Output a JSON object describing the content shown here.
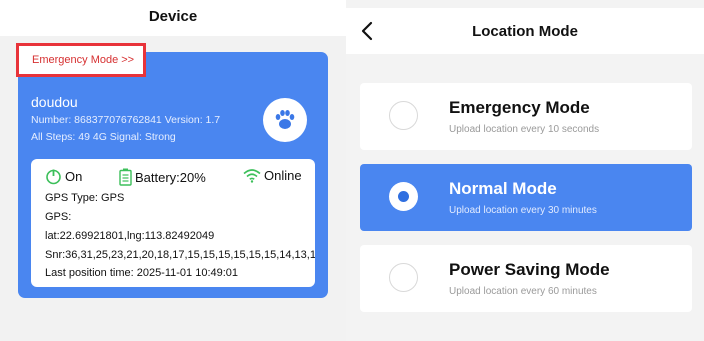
{
  "left": {
    "title": "Device",
    "emergency_link": "Emergency Mode >>",
    "device": {
      "name": "doudou",
      "number_line": "Number: 868377076762841  Version: 1.7",
      "steps_line": "All Steps: 49  4G Signal: Strong"
    },
    "status": {
      "power": "On",
      "battery": "Battery:20%",
      "network": "Online"
    },
    "info": {
      "gps_type": "GPS Type:  GPS",
      "gps_label": "GPS:",
      "gps_coords": "lat:22.69921801,lng:113.82492049",
      "snr": "Snr:36,31,25,23,21,20,18,17,15,15,15,15,15,15,14,13,1",
      "last_position": "Last position time:  2025-11-01 10:49:01"
    }
  },
  "right": {
    "title": "Location Mode",
    "modes": [
      {
        "name": "Emergency Mode",
        "desc": "Upload location every 10 seconds",
        "selected": false
      },
      {
        "name": "Normal Mode",
        "desc": "Upload location every 30 minutes",
        "selected": true
      },
      {
        "name": "Power Saving Mode",
        "desc": "Upload location every 60 minutes",
        "selected": false
      }
    ]
  },
  "colors": {
    "accent": "#4a86f0",
    "highlight_border": "#e8333a",
    "status_green": "#3cbf5a"
  },
  "icons": [
    "paw-icon",
    "power-icon",
    "battery-icon",
    "wifi-icon",
    "chevron-left-icon"
  ]
}
